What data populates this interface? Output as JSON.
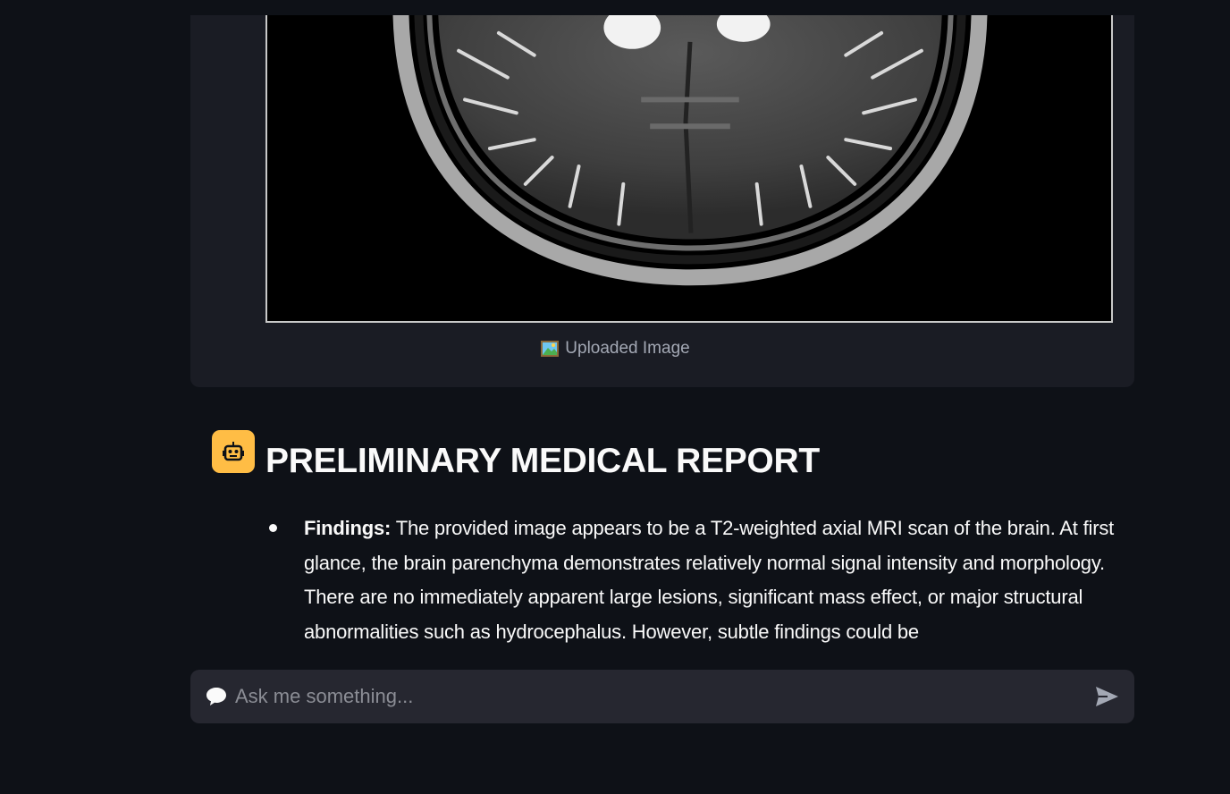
{
  "image_card": {
    "caption_icon": "framed-picture-icon",
    "caption": "Uploaded Image"
  },
  "report": {
    "avatar_icon": "robot-icon",
    "title": "PRELIMINARY MEDICAL REPORT",
    "findings_label": "Findings:",
    "findings_text": " The provided image appears to be a T2-weighted axial MRI scan of the brain. At first glance, the brain parenchyma demonstrates relatively normal signal intensity and morphology. There are no immediately apparent large lesions, significant mass effect, or major structural abnormalities such as hydrocephalus. However, subtle findings could be"
  },
  "chat": {
    "icon": "speech-bubble-icon",
    "placeholder": "Ask me something...",
    "value": "",
    "send_icon": "send-arrow-icon"
  },
  "colors": {
    "background": "#0e1117",
    "card": "#1a1c24",
    "input": "#262730",
    "avatar": "#ffbd45",
    "text": "#fafafa",
    "muted": "#a3a8b4"
  }
}
